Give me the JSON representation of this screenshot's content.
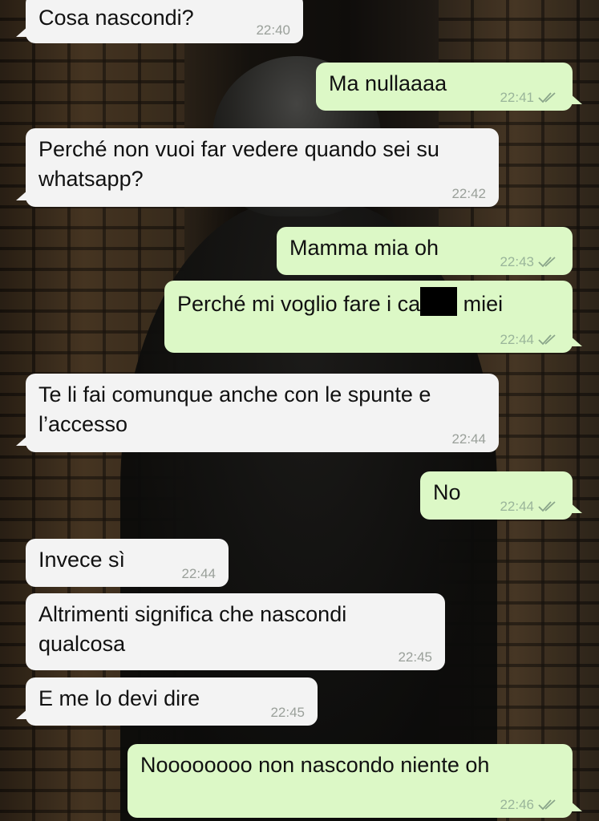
{
  "colors": {
    "incoming_bubble": "#f3f3f3",
    "outgoing_bubble": "#dcf8c6",
    "timestamp": "#9aa09a"
  },
  "messages": [
    {
      "dir": "in",
      "text": "Cosa nascondi?",
      "time": "22:40"
    },
    {
      "dir": "out",
      "text": "Ma nullaaaa",
      "time": "22:41",
      "ticks": "double-check-icon"
    },
    {
      "dir": "in",
      "text": "Perché non vuoi far vedere quando sei su whatsapp?",
      "line1": "Perché non vuoi far vedere quando sei",
      "line2": "su whatsapp?",
      "time": "22:42"
    },
    {
      "dir": "out",
      "text": "Mamma mia oh",
      "time": "22:43",
      "ticks": "double-check-icon"
    },
    {
      "dir": "out",
      "text_before": "Perché mi voglio fare i ca",
      "text_after": " miei",
      "time": "22:44",
      "ticks": "double-check-icon"
    },
    {
      "dir": "in",
      "line1": "Te li fai comunque anche con le",
      "line2": "spunte e l’accesso",
      "time": "22:44"
    },
    {
      "dir": "out",
      "text": "No",
      "time": "22:44",
      "ticks": "double-check-icon"
    },
    {
      "dir": "in",
      "text": "Invece sì",
      "time": "22:44"
    },
    {
      "dir": "in",
      "line1": "Altrimenti significa che",
      "line2": "nascondi qualcosa",
      "time": "22:45"
    },
    {
      "dir": "in",
      "text": "E me lo devi dire",
      "time": "22:45"
    },
    {
      "dir": "out",
      "text": "Noooooooo non nascondo niente oh",
      "time": "22:46",
      "ticks": "double-check-icon"
    }
  ]
}
